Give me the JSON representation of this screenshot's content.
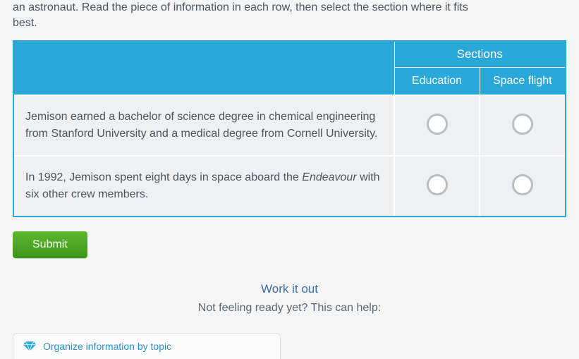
{
  "instruction_prefix": "an astronaut. Read the piece of information in each row, then select the section where it fits",
  "instruction_suffix": "best.",
  "table": {
    "sections_header": "Sections",
    "columns": [
      "Education",
      "Space flight"
    ],
    "rows": [
      {
        "text": "Jemison earned a bachelor of science degree in chemical engineering from Stanford University and a medical degree from Cornell University."
      },
      {
        "text_pre": "In 1992, Jemison spent eight days in space aboard the ",
        "text_italic": "Endeavour",
        "text_post": " with six other crew members."
      }
    ]
  },
  "buttons": {
    "submit": "Submit"
  },
  "hints": {
    "work_it_out": "Work it out",
    "not_ready": "Not feeling ready yet? This can help:",
    "help_link": "Organize information by topic"
  },
  "icons": {
    "diamond": "diamond-icon"
  }
}
